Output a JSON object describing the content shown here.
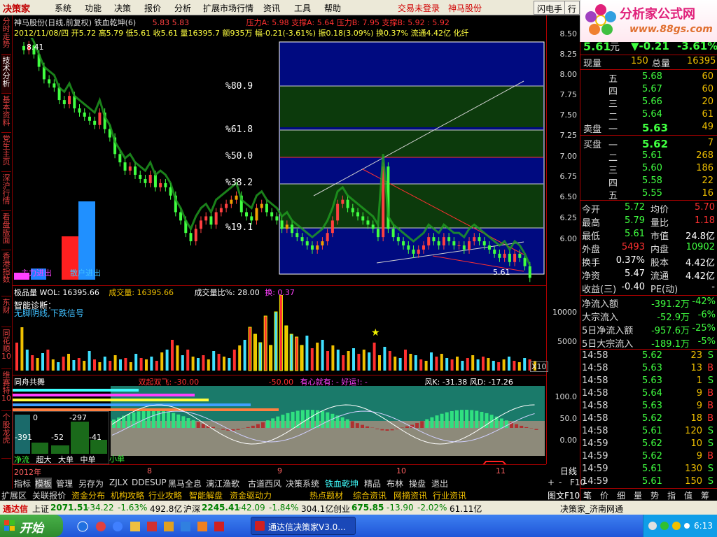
{
  "menu": {
    "logo": "决策家",
    "items": [
      "系统",
      "功能",
      "决策",
      "报价",
      "分析",
      "扩展市场行情",
      "资讯",
      "工具",
      "帮助"
    ],
    "notice1": "交易未登录",
    "notice2": "神马股份",
    "btn1": "闪电手",
    "btn2": "行"
  },
  "brand": {
    "title": "分析家公式网",
    "url": "www.88gs.com"
  },
  "leftbar": [
    "分时走势",
    "技术分析",
    "基本资料",
    "党生主页",
    "深沪行情",
    "看盘版面",
    "香港指数",
    "东财",
    "同花顺10",
    "维赛特10",
    "个股龙虎"
  ],
  "header": {
    "line1": "神马股份(日线,前复权) 铁血乾坤(6)",
    "line1b": "5.83  5.83",
    "line1c": "压力A: 5.98  支撑A: 5.64  压力B: 7.95  支撑B: 5.92  : 5.92",
    "line2": "2012/11/08/四 开5.72 高5.79 低5.61 收5.61 量16395.7 额935万 幅-0.21(-3.61%) 振0.18(3.09%) 换0.37% 流通4.42亿 化纤"
  },
  "chart_labels": {
    "peak": "8.41",
    "low": "5.61",
    "fib": [
      "%80.9",
      "%61.8",
      "%50.0",
      "%38.2",
      "%19.1"
    ],
    "bar1": "主力进出",
    "bar2": "散户进出"
  },
  "vol_panel": {
    "title": "极品量 WOL: 16395.66",
    "c2": "成交量: 16395.66",
    "c3": "成交量比%: 28.00",
    "c4": "换: 0.37",
    "diag": "智能诊断：",
    "diag2": "无脚阴线,下跌信号",
    "y1": "10000",
    "y2": "5000",
    "x10": "X10"
  },
  "flow_panel": {
    "title": "同舟共舞",
    "t2": "双起双飞: -30.00",
    "t3": "-50.00",
    "t4": "有心就有: - 好运!: -",
    "t5": "风K: -31.38 风D: -17.26",
    "y": [
      "100.0",
      "50.0",
      "0.00"
    ],
    "box": {
      "v1": "0",
      "v2": "-297",
      "v3": "-391",
      "v4": "-52",
      "v5": "-41"
    },
    "legend": [
      "净流",
      "超大",
      "大单",
      "中单",
      "小单"
    ]
  },
  "xaxis": {
    "labels": [
      "2012年",
      "8",
      "9",
      "10",
      "11"
    ],
    "right": "日线"
  },
  "price_axis": [
    "8.50",
    "8.25",
    "8.00",
    "7.75",
    "7.50",
    "7.25",
    "7.00",
    "6.75",
    "6.50",
    "6.25",
    "6.00"
  ],
  "quote": {
    "price": "5.61",
    "unit": "元",
    "change": "▼-0.21",
    "pct": "-3.61%",
    "xianliang_label": "现量",
    "xianliang": "150",
    "zongliang_label": "总量",
    "zongliang": "16395",
    "sell": [
      {
        "n": "五",
        "p": "5.68",
        "v": "60"
      },
      {
        "n": "四",
        "p": "5.67",
        "v": "60"
      },
      {
        "n": "三",
        "p": "5.66",
        "v": "20"
      },
      {
        "n": "二",
        "p": "5.64",
        "v": "61"
      },
      {
        "n": "一",
        "p": "5.63",
        "v": "49"
      }
    ],
    "sell_label": "卖盘",
    "buy_label": "买盘",
    "buy": [
      {
        "n": "一",
        "p": "5.62",
        "v": "7"
      },
      {
        "n": "二",
        "p": "5.61",
        "v": "268"
      },
      {
        "n": "三",
        "p": "5.60",
        "v": "186"
      },
      {
        "n": "四",
        "p": "5.58",
        "v": "22"
      },
      {
        "n": "五",
        "p": "5.55",
        "v": "16"
      }
    ],
    "stats": [
      [
        "今开",
        "5.72",
        "均价",
        "5.70"
      ],
      [
        "最高",
        "5.79",
        "量比",
        "1.18"
      ],
      [
        "最低",
        "5.61",
        "市值",
        "24.8亿"
      ],
      [
        "外盘",
        "5493",
        "内盘",
        "10902"
      ],
      [
        "换手",
        "0.37%",
        "股本",
        "4.42亿"
      ],
      [
        "净资",
        "5.47",
        "流通",
        "4.42亿"
      ],
      [
        "收益(三)",
        "-0.40",
        "PE(动)",
        "-"
      ]
    ],
    "flows": [
      [
        "净流入额",
        "-391.2万",
        "-42%"
      ],
      [
        "大宗流入",
        "-52.9万",
        "-6%"
      ],
      [
        "5日净流入额",
        "-957.6万",
        "-25%"
      ],
      [
        "5日大宗流入",
        "-189.1万",
        "-5%"
      ]
    ],
    "ticks": [
      [
        "14:58",
        "5.62",
        "23",
        "S"
      ],
      [
        "14:58",
        "5.63",
        "13",
        "B"
      ],
      [
        "14:58",
        "5.63",
        "1",
        "S"
      ],
      [
        "14:58",
        "5.64",
        "9",
        "B"
      ],
      [
        "14:58",
        "5.63",
        "9",
        "B"
      ],
      [
        "14:58",
        "5.62",
        "18",
        "B"
      ],
      [
        "14:58",
        "5.61",
        "120",
        "S"
      ],
      [
        "14:59",
        "5.62",
        "10",
        "S"
      ],
      [
        "14:59",
        "5.62",
        "9",
        "B"
      ],
      [
        "14:59",
        "5.61",
        "130",
        "S"
      ],
      [
        "14:59",
        "5.61",
        "150",
        "S"
      ]
    ],
    "bottom_tabs": [
      "笔",
      "价",
      "细",
      "量",
      "势",
      "指",
      "值",
      "筹"
    ]
  },
  "tabs1": [
    "指标",
    "模板",
    "管理",
    "另存为",
    "ZJLX",
    "DDE",
    "SUP",
    "黑马全息",
    "漓江渔歌",
    "古道西风",
    "决策系统",
    "铁血乾坤",
    "精品",
    "布林",
    "操盘",
    "退出"
  ],
  "tabs1_right": [
    "+",
    "-",
    "F10"
  ],
  "tabs2": [
    "扩展区",
    "关联报价",
    "资金分布",
    "机构攻略",
    "行业攻略",
    "智能解盘",
    "资金驱动力",
    "热点题材",
    "综合资讯",
    "网摘资讯",
    "行业资讯"
  ],
  "tabs2_right": "图文F10",
  "ticker": {
    "brand": "通达信",
    "sh_label": "上证",
    "sh": "2071.51",
    "sh_ch": "-34.22",
    "sh_pct": "-1.63%",
    "sh_amt": "492.8亿",
    "sz_label": "沪深",
    "sz": "2245.41",
    "sz_ch": "-42.09",
    "sz_pct": "-1.84%",
    "sz_amt": "304.1亿",
    "cy_label": "创业",
    "cy": "675.85",
    "cy_ch": "-13.90",
    "cy_pct": "-2.02%",
    "cy_amt": "61.11亿",
    "right": "决策家_济南网通"
  },
  "taskbar": {
    "start": "开始",
    "item": "通达信决策家V3.0...",
    "time": "6:13"
  }
}
